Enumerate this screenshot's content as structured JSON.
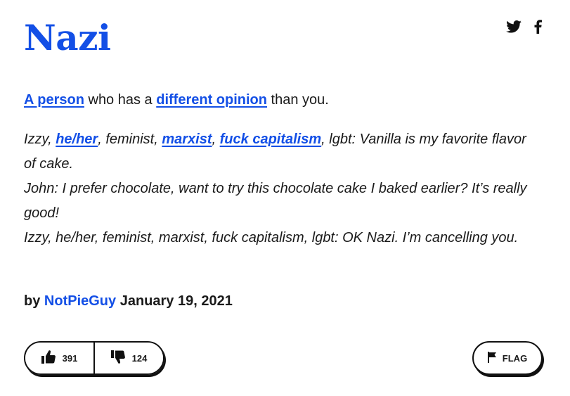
{
  "definition": {
    "word": "Nazi",
    "meaning": {
      "link1": "A person",
      "text1": " who has a ",
      "link2": "different opinion",
      "text2": " than you."
    },
    "example": {
      "l1_t1": "Izzy, ",
      "l1_link1": "he/her",
      "l1_t2": ", feminist, ",
      "l1_link2": "marxist",
      "l1_t3": ", ",
      "l1_link3": "fuck capitalism",
      "l1_t4": ", lgbt: Vanilla is my favorite flavor of cake.",
      "l2": "John: I prefer chocolate, want to try this chocolate cake I baked earlier? It’s really good!",
      "l3": "Izzy, he/her, feminist, marxist, fuck capitalism, lgbt: OK Nazi. I’m cancelling you."
    },
    "contributor": {
      "by": "by ",
      "author": "NotPieGuy",
      "date": " January 19, 2021"
    }
  },
  "share": {
    "twitter_icon": "twitter-icon",
    "facebook_icon": "facebook-icon"
  },
  "votes": {
    "upvotes": "391",
    "downvotes": "124",
    "thumbs_up_icon": "thumbs-up-icon",
    "thumbs_down_icon": "thumbs-down-icon"
  },
  "flag": {
    "label": "FLAG",
    "icon": "flag-icon"
  },
  "colors": {
    "accent": "#134fe6",
    "text": "#1a1a1a",
    "border": "#111111"
  }
}
